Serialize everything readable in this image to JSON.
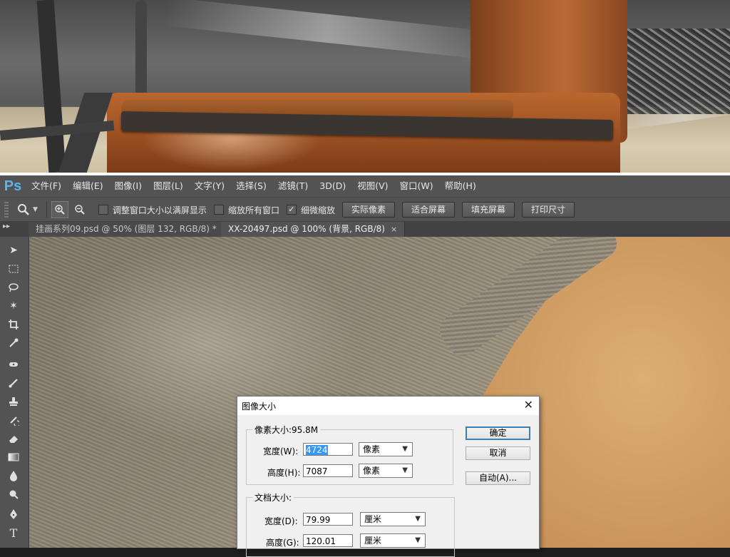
{
  "app": {
    "logo": "Ps"
  },
  "menubar": {
    "items": [
      "文件(F)",
      "编辑(E)",
      "图像(I)",
      "图层(L)",
      "文字(Y)",
      "选择(S)",
      "滤镜(T)",
      "3D(D)",
      "视图(V)",
      "窗口(W)",
      "帮助(H)"
    ]
  },
  "options_bar": {
    "tool_icon": "zoom-icon",
    "checkboxes": [
      {
        "label": "调整窗口大小以满屏显示",
        "checked": false
      },
      {
        "label": "缩放所有窗口",
        "checked": false
      },
      {
        "label": "细微缩放",
        "checked": true
      }
    ],
    "buttons": [
      "实际像素",
      "适合屏幕",
      "填充屏幕",
      "打印尺寸"
    ]
  },
  "tabs": [
    {
      "label": "挂画系列09.psd @ 50% (图层 132, RGB/8) *",
      "active": false
    },
    {
      "label": "XX-20497.psd @ 100% (背景, RGB/8)",
      "active": true
    }
  ],
  "tools": [
    "move-icon",
    "marquee-icon",
    "lasso-icon",
    "magic-wand-icon",
    "crop-icon",
    "eyedropper-icon",
    "healing-brush-icon",
    "brush-icon",
    "clone-stamp-icon",
    "history-brush-icon",
    "eraser-icon",
    "gradient-icon",
    "blur-icon",
    "dodge-icon",
    "pen-icon",
    "type-icon"
  ],
  "dialog": {
    "title": "图像大小",
    "pixel_dimensions_label": "像素大小:95.8M",
    "width_label": "宽度(W):",
    "width_value": "4724",
    "width_unit": "像素",
    "height_label": "高度(H):",
    "height_value": "7087",
    "height_unit": "像素",
    "document_size_label": "文档大小:",
    "doc_width_label": "宽度(D):",
    "doc_width_value": "79.99",
    "doc_width_unit": "厘米",
    "doc_height_label": "高度(G):",
    "doc_height_value": "120.01",
    "doc_height_unit": "厘米",
    "ok_label": "确定",
    "cancel_label": "取消",
    "auto_label": "自动(A)..."
  },
  "colors": {
    "accent": "#5db3f0",
    "panel": "#535353",
    "dialog_bg": "#f0f0f0"
  }
}
